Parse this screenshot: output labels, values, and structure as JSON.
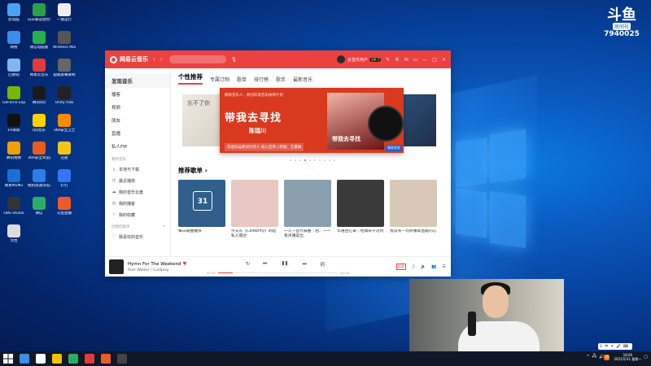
{
  "desktop": {
    "icons": [
      {
        "label": "此电脑",
        "color": "#4aa3f0"
      },
      {
        "label": "向日葵远程控制",
        "color": "#2aa149"
      },
      {
        "label": "一键运行",
        "color": "#eeeeee"
      },
      {
        "label": "网络",
        "color": "#3d8ee8"
      },
      {
        "label": "微信电脑版",
        "color": "#24b34a"
      },
      {
        "label": "Wireless Mouse",
        "color": "#555555"
      },
      {
        "label": "回收站",
        "color": "#7fb8ee"
      },
      {
        "label": "网易云音乐",
        "color": "#e23b3b"
      },
      {
        "label": "超级屏幕录制",
        "color": "#666666"
      },
      {
        "label": "GeForce Experience",
        "color": "#76b900"
      },
      {
        "label": "腾讯QQ",
        "color": "#1a1a1a"
      },
      {
        "label": "Unity Hub",
        "color": "#222222"
      },
      {
        "label": "EV录屏",
        "color": "#111111"
      },
      {
        "label": "QQ音乐",
        "color": "#ffd200"
      },
      {
        "label": "360安全卫士",
        "color": "#ff8a00"
      },
      {
        "label": "腾讯视频",
        "color": "#f0a000"
      },
      {
        "label": "360安全浏览器",
        "color": "#e85d1a"
      },
      {
        "label": "迅雷",
        "color": "#f3c51a"
      },
      {
        "label": "网易MuMu",
        "color": "#1b6fd6"
      },
      {
        "label": "搜狗高速浏览器",
        "color": "#2e7de9"
      },
      {
        "label": "钉钉",
        "color": "#3277f6"
      },
      {
        "label": "OBS Studio",
        "color": "#333333"
      },
      {
        "label": "微信",
        "color": "#2aae67"
      },
      {
        "label": "斗鱼直播",
        "color": "#f05a24"
      },
      {
        "label": "文档",
        "color": "#dddddd"
      }
    ]
  },
  "room_badge": {
    "logo": "斗鱼",
    "tag": "房间号",
    "number": "7940025"
  },
  "app": {
    "name": "网易云音乐",
    "user": {
      "name": "云音乐用户",
      "vip": "VIP 7"
    },
    "sidebar": {
      "items": [
        "发现音乐",
        "播客",
        "视频",
        "朋友",
        "直播",
        "私人FM"
      ],
      "my_music_title": "我的音乐",
      "my_music": [
        {
          "icon": "⤓",
          "label": "本地与下载"
        },
        {
          "icon": "◷",
          "label": "最近播放"
        },
        {
          "icon": "☁",
          "label": "我的音乐云盘"
        },
        {
          "icon": "◎",
          "label": "我的播客"
        },
        {
          "icon": "☆",
          "label": "我的收藏"
        }
      ],
      "created_title": "创建的歌单",
      "created_add": "+",
      "created": [
        {
          "icon": "♡",
          "label": "我喜欢的音乐"
        }
      ]
    },
    "tabs": [
      "个性推荐",
      "专属订制",
      "歌单",
      "排行榜",
      "歌手",
      "最新音乐"
    ],
    "banner": {
      "tagline": "网易音乐人 · 原创华语音乐扶持计划",
      "title": "带我去寻找",
      "artist": "陈瑞川",
      "desc": "华语乐坛原创力作人 初心坚持 | 原唱：王嘉琳",
      "photo_text": "带我去寻找",
      "badge": "独家首发",
      "left_text": "忘不了你",
      "dots_total": 10,
      "dots_active": 3
    },
    "recommend_title": "推荐歌单 ›",
    "calendar_day": "31",
    "playlists": [
      {
        "caption": "每日歌曲推荐",
        "color": "#2f5f8a"
      },
      {
        "caption": "今天从《Celebrity》听起私人雷达",
        "color": "#e9c7c2"
      },
      {
        "caption": "一人一首代表曲｜若、一一有点难说出",
        "color": "#8aa0b0"
      },
      {
        "caption": "华语回忆录｜经典永不过时",
        "color": "#3a3a3a"
      },
      {
        "caption": "我没有一句听懂却直戳内心",
        "color": "#d7c9b6"
      }
    ],
    "player": {
      "song": "Hymn For The Weekend",
      "artist": "Alan Walker / Coldplay",
      "current": "00:30",
      "total": "04:18",
      "quality": "标准",
      "progress": 0.12
    }
  },
  "taskbar": {
    "items": [
      "#3b8fe8",
      "#ffffff",
      "#f2c200",
      "#2aae67",
      "#e23b3b",
      "#f05a24",
      "#444444"
    ],
    "time": "18:00",
    "date": "2021/5/31 星期一",
    "ime": [
      "S",
      "中",
      "✦",
      "🎤",
      "⌨"
    ]
  }
}
